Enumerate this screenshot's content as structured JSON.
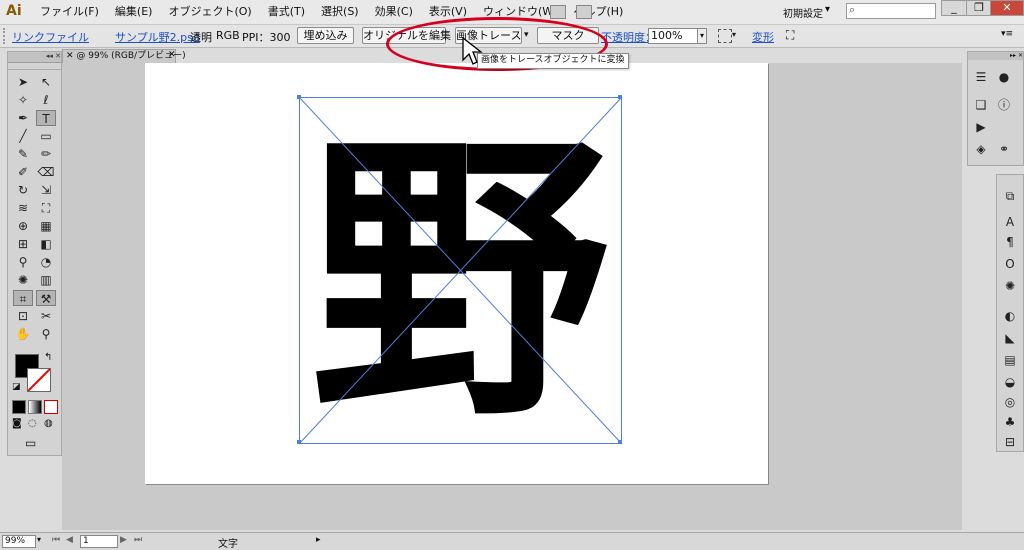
{
  "app": {
    "logo": "Ai",
    "workspace": "初期設定"
  },
  "menu": [
    "ファイル(F)",
    "編集(E)",
    "オブジェクト(O)",
    "書式(T)",
    "選択(S)",
    "効果(C)",
    "表示(V)",
    "ウィンドウ(W)",
    "ヘルプ(H)"
  ],
  "window_controls": {
    "minimize": "_",
    "restore": "❐",
    "close": "✕"
  },
  "control_bar": {
    "linked_file_label": "リンクファイル",
    "file_name": "サンプル野2.psd",
    "transparency": "透明",
    "color_mode": "RGB",
    "ppi": "PPI：300",
    "embed_button": "埋め込み",
    "edit_original_button": "オリジナルを編集",
    "image_trace_button": "画像トレース",
    "mask_button": "マスク",
    "opacity_label": "不透明度：",
    "opacity_value": "100%",
    "transform_link": "変形"
  },
  "tooltip": "画像をトレースオブジェクトに変換",
  "document_tab": "@ 99% (RGB/プレビュー)",
  "canvas": {
    "glyph_text": "野"
  },
  "status_bar": {
    "zoom": "99%",
    "page": "1",
    "tool_name": "文字"
  },
  "colors": {
    "accent": "#1b4fc7",
    "annotation": "#d4001f",
    "selection": "#4e7fdc"
  },
  "icons": {
    "tools": [
      "selection-tool",
      "direct-selection-tool",
      "magic-wand-tool",
      "lasso-tool",
      "pen-tool",
      "type-tool",
      "line-tool",
      "rectangle-tool",
      "paintbrush-tool",
      "pencil-tool",
      "blob-brush-tool",
      "eraser-tool",
      "rotate-tool",
      "scale-tool",
      "warp-tool",
      "free-transform-tool",
      "shape-builder-tool",
      "perspective-grid-tool",
      "mesh-tool",
      "gradient-tool",
      "eyedropper-tool",
      "blend-tool",
      "symbol-sprayer-tool",
      "column-graph-tool",
      "artboard-tool",
      "slice-tool",
      "hand-tool",
      "zoom-tool"
    ]
  }
}
